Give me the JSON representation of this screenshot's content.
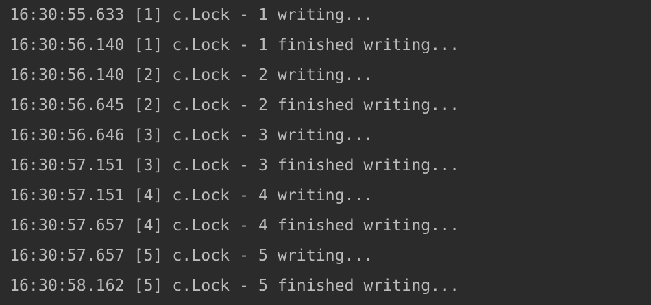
{
  "console": {
    "lines": [
      "16:30:55.633 [1] c.Lock - 1 writing...",
      "16:30:56.140 [1] c.Lock - 1 finished writing...",
      "16:30:56.140 [2] c.Lock - 2 writing...",
      "16:30:56.645 [2] c.Lock - 2 finished writing...",
      "16:30:56.646 [3] c.Lock - 3 writing...",
      "16:30:57.151 [3] c.Lock - 3 finished writing...",
      "16:30:57.151 [4] c.Lock - 4 writing...",
      "16:30:57.657 [4] c.Lock - 4 finished writing...",
      "16:30:57.657 [5] c.Lock - 5 writing...",
      "16:30:58.162 [5] c.Lock - 5 finished writing..."
    ]
  },
  "colors": {
    "background": "#2b2b2b",
    "text": "#bbbbbb"
  }
}
